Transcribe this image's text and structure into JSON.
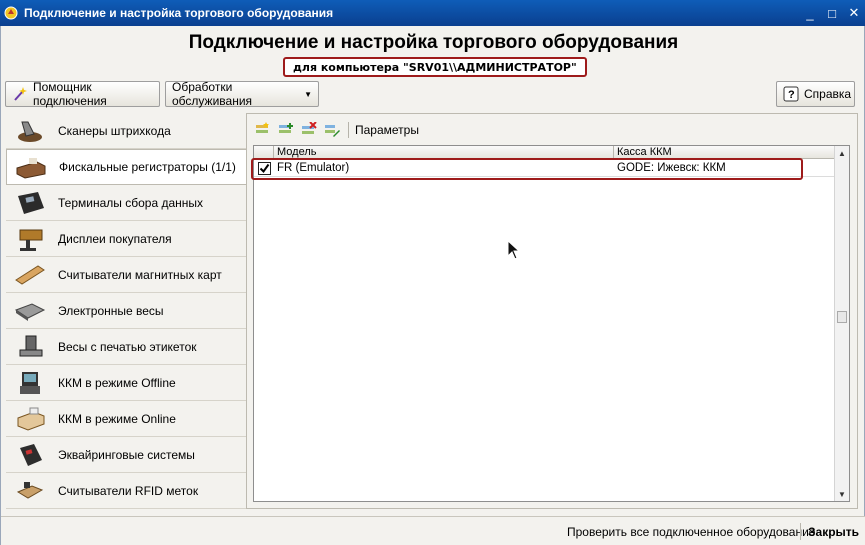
{
  "window": {
    "title": "Подключение и настройка торгового оборудования",
    "controls": {
      "minimize": "_",
      "maximize": "□",
      "close": "✕"
    }
  },
  "header": {
    "title": "Подключение и настройка торгового оборудования",
    "computer": "для компьютера \"SRV01\\\\АДМИНИСТРАТОР\""
  },
  "buttons": {
    "connection_wizard": "Помощник подключения",
    "service_processing": "Обработки обслуживания",
    "help": "Справка"
  },
  "sidebar": {
    "items": [
      {
        "label": "Сканеры штрихкода",
        "icon": "barcode-scanner-icon",
        "active": false
      },
      {
        "label": "Фискальные регистраторы (1/1)",
        "icon": "fiscal-registrar-icon",
        "active": true
      },
      {
        "label": "Терминалы сбора данных",
        "icon": "data-terminal-icon",
        "active": false
      },
      {
        "label": "Дисплеи покупателя",
        "icon": "customer-display-icon",
        "active": false
      },
      {
        "label": "Считыватели магнитных карт",
        "icon": "card-reader-icon",
        "active": false
      },
      {
        "label": "Электронные весы",
        "icon": "scales-icon",
        "active": false
      },
      {
        "label": "Весы с печатью этикеток",
        "icon": "label-scales-icon",
        "active": false
      },
      {
        "label": "ККМ в режиме Offline",
        "icon": "kkm-offline-icon",
        "active": false
      },
      {
        "label": "ККМ в режиме Online",
        "icon": "kkm-online-icon",
        "active": false
      },
      {
        "label": "Эквайринговые системы",
        "icon": "acquiring-terminal-icon",
        "active": false
      },
      {
        "label": "Считыватели RFID меток",
        "icon": "rfid-reader-icon",
        "active": false
      }
    ]
  },
  "panel": {
    "toolbar": {
      "params_label": "Параметры"
    },
    "table": {
      "columns": [
        "Модель",
        "Касса ККМ"
      ],
      "rows": [
        {
          "checked": true,
          "model": "FR (Emulator)",
          "kkm": "GODE: Ижевск: ККМ"
        }
      ]
    }
  },
  "footer": {
    "check_all": "Проверить все подключенное оборудование",
    "close": "Закрыть"
  },
  "colors": {
    "titlebar": "#0a4aa6",
    "highlight_border": "#9e1b1b",
    "window_bg": "#f3f2ee"
  }
}
